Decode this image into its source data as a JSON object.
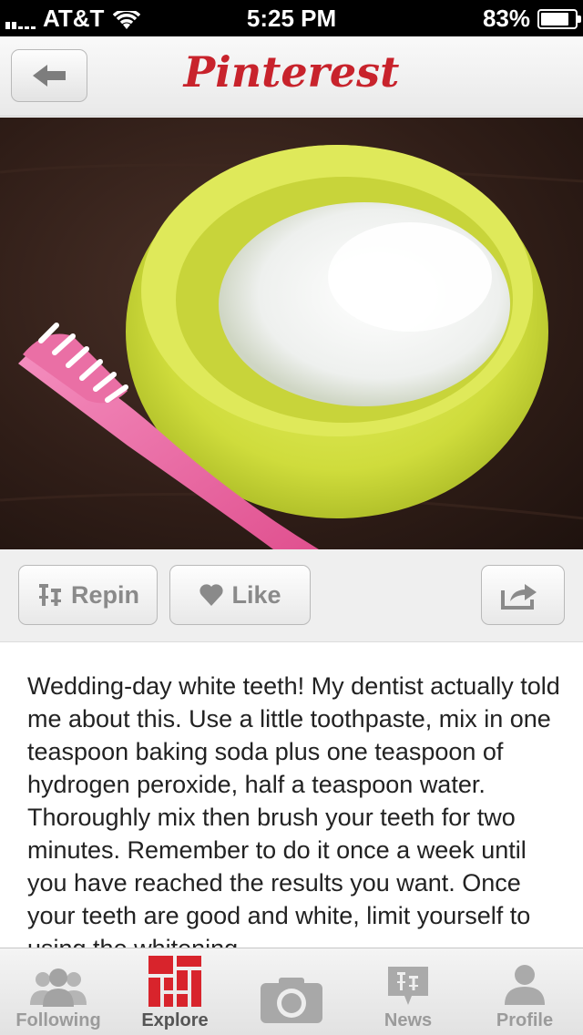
{
  "status_bar": {
    "carrier": "AT&T",
    "time": "5:25 PM",
    "battery_percent": "83%",
    "battery_level": 0.83,
    "icons": [
      "signal-icon",
      "wifi-icon",
      "battery-icon"
    ]
  },
  "nav": {
    "logo_text": "Pinterest",
    "back_icon": "back-arrow-icon"
  },
  "pin": {
    "image_description_icon": "pin-photo",
    "actions": {
      "repin_label": "Repin",
      "like_label": "Like",
      "share_icon": "share-icon"
    },
    "description": "Wedding-day white teeth! My dentist actually told me about this. Use a little toothpaste, mix in one teaspoon baking soda plus one teaspoon of hydrogen peroxide, half a teaspoon water. Thoroughly mix then brush your teeth for two minutes. Remember to do it once a week until you have reached the results you want. Once your teeth are good and white, limit yourself to using the whitening"
  },
  "tab_bar": {
    "tabs": [
      {
        "label": "Following",
        "icon": "following-icon",
        "active": false
      },
      {
        "label": "Explore",
        "icon": "explore-icon",
        "active": true
      },
      {
        "label": "",
        "icon": "camera-icon",
        "active": false
      },
      {
        "label": "News",
        "icon": "news-icon",
        "active": false
      },
      {
        "label": "Profile",
        "icon": "profile-icon",
        "active": false
      }
    ]
  },
  "colors": {
    "brand_red": "#c8232c",
    "inactive_gray": "#9b9b9b"
  }
}
